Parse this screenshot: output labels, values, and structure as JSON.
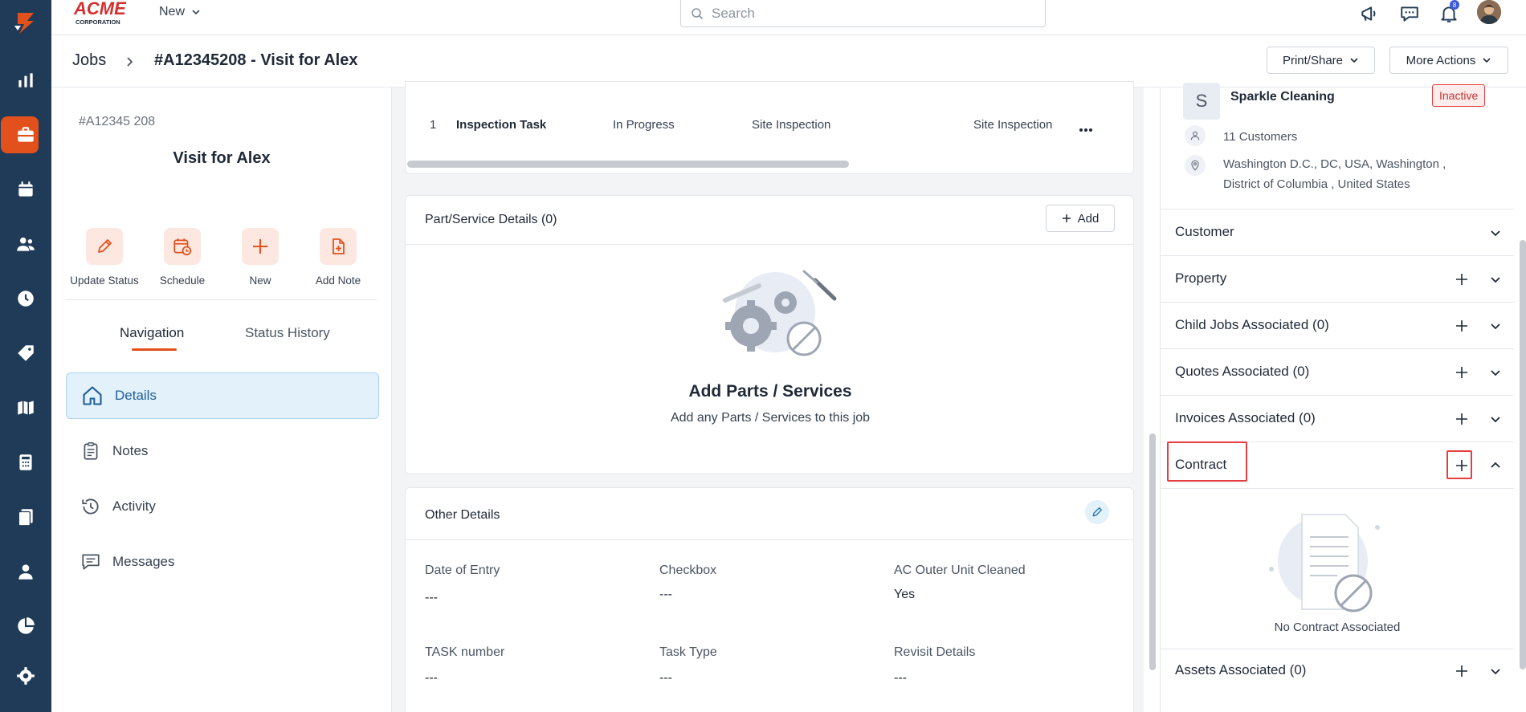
{
  "brand": {
    "name": "ACME",
    "subtitle": "CORPORATION"
  },
  "topbar": {
    "new_label": "New",
    "search_placeholder": "Search",
    "notification_count": "8"
  },
  "breadcrumb": {
    "root": "Jobs",
    "current": "#A12345208 - Visit for Alex"
  },
  "header_actions": {
    "print_share": "Print/Share",
    "more_actions": "More Actions"
  },
  "job": {
    "number": "#A12345 208",
    "name": "Visit for Alex"
  },
  "quick_actions": [
    {
      "label": "Update Status",
      "icon": "pencil-icon"
    },
    {
      "label": "Schedule",
      "icon": "calendar-clock-icon"
    },
    {
      "label": "New",
      "icon": "plus-icon"
    },
    {
      "label": "Add Note",
      "icon": "note-add-icon"
    }
  ],
  "tabs": {
    "navigation": "Navigation",
    "status_history": "Status History"
  },
  "nav": [
    {
      "label": "Details",
      "icon": "home-icon",
      "active": true
    },
    {
      "label": "Notes",
      "icon": "clipboard-icon"
    },
    {
      "label": "Activity",
      "icon": "history-icon"
    },
    {
      "label": "Messages",
      "icon": "message-icon"
    }
  ],
  "task_row": {
    "index": "1",
    "name": "Inspection Task",
    "status": "In Progress",
    "type": "Site Inspection",
    "category": "Site Inspection"
  },
  "parts": {
    "header": "Part/Service Details (0)",
    "add": "Add",
    "empty_title": "Add Parts / Services",
    "empty_text": "Add any Parts / Services to this job"
  },
  "other_details": {
    "header": "Other Details",
    "fields": [
      {
        "label": "Date of Entry",
        "value": "---"
      },
      {
        "label": "Checkbox",
        "value": "---"
      },
      {
        "label": "AC Outer Unit Cleaned",
        "value": "Yes"
      },
      {
        "label": "TASK number",
        "value": "---"
      },
      {
        "label": "Task Type",
        "value": "---"
      },
      {
        "label": "Revisit Details",
        "value": "---"
      }
    ]
  },
  "company": {
    "initial": "S",
    "name": "Sparkle Cleaning",
    "status": "Inactive",
    "customers": "11 Customers",
    "address_line1": "Washington D.C., DC, USA, Washington ,",
    "address_line2": "District of Columbia , United States"
  },
  "sections": [
    {
      "title": "Customer"
    },
    {
      "title": "Property"
    },
    {
      "title": "Child Jobs Associated (0)"
    },
    {
      "title": "Quotes Associated (0)"
    },
    {
      "title": "Invoices Associated (0)"
    },
    {
      "title": "Contract"
    },
    {
      "title": "Assets Associated (0)"
    }
  ],
  "contract_empty": "No Contract Associated",
  "colors": {
    "accent": "#e2501b",
    "rail": "#1f3b57",
    "highlight": "#e53e3e",
    "active_nav": "#e3f1fb"
  }
}
